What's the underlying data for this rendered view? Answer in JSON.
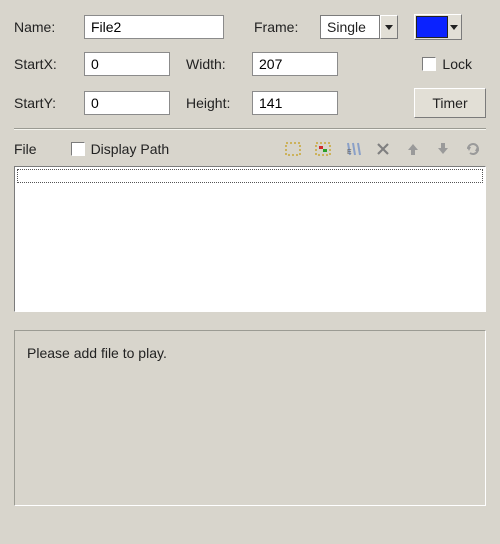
{
  "labels": {
    "name": "Name:",
    "frame": "Frame:",
    "startX": "StartX:",
    "width": "Width:",
    "startY": "StartY:",
    "height": "Height:",
    "lock": "Lock",
    "timer": "Timer",
    "file": "File",
    "displayPath": "Display Path"
  },
  "values": {
    "name": "File2",
    "frame": "Single",
    "startX": "0",
    "width": "207",
    "startY": "0",
    "height": "141",
    "lockChecked": false,
    "displayPathChecked": false,
    "color": "#0a22ff"
  },
  "preview": {
    "message": "Please add file to play."
  },
  "icons": {
    "select": "select-rect-icon",
    "selectColor": "select-color-icon",
    "effects": "effects-icon",
    "delete": "delete-icon",
    "moveUp": "move-up-icon",
    "moveDown": "move-down-icon",
    "refresh": "refresh-icon"
  }
}
